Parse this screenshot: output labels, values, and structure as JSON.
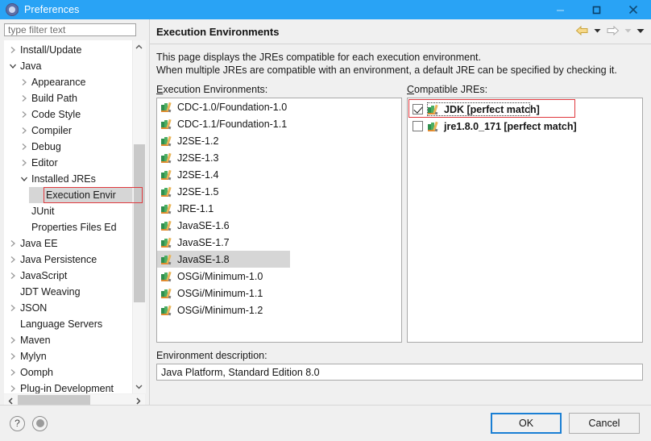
{
  "window": {
    "title": "Preferences",
    "icon": "gear-icon",
    "accent_blue": "#29a3f5",
    "controls": {
      "minimize": "minimize-icon",
      "maximize": "maximize-icon",
      "close": "close-icon"
    }
  },
  "sidebar": {
    "filter": {
      "placeholder": "type filter text",
      "value": ""
    },
    "items": [
      {
        "label": "Install/Update",
        "level": 1,
        "twisty": "collapsed"
      },
      {
        "label": "Java",
        "level": 1,
        "twisty": "expanded"
      },
      {
        "label": "Appearance",
        "level": 2,
        "twisty": "collapsed"
      },
      {
        "label": "Build Path",
        "level": 2,
        "twisty": "collapsed"
      },
      {
        "label": "Code Style",
        "level": 2,
        "twisty": "collapsed"
      },
      {
        "label": "Compiler",
        "level": 2,
        "twisty": "collapsed"
      },
      {
        "label": "Debug",
        "level": 2,
        "twisty": "collapsed"
      },
      {
        "label": "Editor",
        "level": 2,
        "twisty": "collapsed"
      },
      {
        "label": "Installed JREs",
        "level": 2,
        "twisty": "expanded"
      },
      {
        "label": "Execution Envir",
        "level": 3,
        "twisty": "none",
        "selected": true,
        "highlighted": true
      },
      {
        "label": "JUnit",
        "level": 2,
        "twisty": "none"
      },
      {
        "label": "Properties Files Ed",
        "level": 2,
        "twisty": "none"
      },
      {
        "label": "Java EE",
        "level": 1,
        "twisty": "collapsed"
      },
      {
        "label": "Java Persistence",
        "level": 1,
        "twisty": "collapsed"
      },
      {
        "label": "JavaScript",
        "level": 1,
        "twisty": "collapsed"
      },
      {
        "label": "JDT Weaving",
        "level": 1,
        "twisty": "none"
      },
      {
        "label": "JSON",
        "level": 1,
        "twisty": "collapsed"
      },
      {
        "label": "Language Servers",
        "level": 1,
        "twisty": "none"
      },
      {
        "label": "Maven",
        "level": 1,
        "twisty": "collapsed"
      },
      {
        "label": "Mylyn",
        "level": 1,
        "twisty": "collapsed"
      },
      {
        "label": "Oomph",
        "level": 1,
        "twisty": "collapsed"
      },
      {
        "label": "Plug-in Development",
        "level": 1,
        "twisty": "collapsed"
      }
    ]
  },
  "page": {
    "title": "Execution Environments",
    "intro_line1": "This page displays the JREs compatible for each execution environment.",
    "intro_line2": "When multiple JREs are compatible with an environment, a default JRE can be specified by checking it.",
    "nav": {
      "back": "back-arrow-icon",
      "back_menu": "chevron-down-icon",
      "forward": "forward-arrow-icon",
      "forward_menu": "chevron-down-icon",
      "view_menu": "chevron-down-icon"
    },
    "environments": {
      "label": "Execution Environments:",
      "label_accesskey": "E",
      "items": [
        {
          "label": "CDC-1.0/Foundation-1.0",
          "selected": false
        },
        {
          "label": "CDC-1.1/Foundation-1.1",
          "selected": false
        },
        {
          "label": "J2SE-1.2",
          "selected": false
        },
        {
          "label": "J2SE-1.3",
          "selected": false
        },
        {
          "label": "J2SE-1.4",
          "selected": false
        },
        {
          "label": "J2SE-1.5",
          "selected": false
        },
        {
          "label": "JRE-1.1",
          "selected": false
        },
        {
          "label": "JavaSE-1.6",
          "selected": false
        },
        {
          "label": "JavaSE-1.7",
          "selected": false
        },
        {
          "label": "JavaSE-1.8",
          "selected": true
        },
        {
          "label": "OSGi/Minimum-1.0",
          "selected": false
        },
        {
          "label": "OSGi/Minimum-1.1",
          "selected": false
        },
        {
          "label": "OSGi/Minimum-1.2",
          "selected": false
        }
      ]
    },
    "compatible_jres": {
      "label": "Compatible JREs:",
      "label_accesskey": "C",
      "items": [
        {
          "label": "JDK [perfect match]",
          "checked": true,
          "focused": true,
          "highlighted": true
        },
        {
          "label": "jre1.8.0_171 [perfect match]",
          "checked": false,
          "focused": false,
          "highlighted": false
        }
      ]
    },
    "description": {
      "label": "Environment description:",
      "value": "Java Platform, Standard Edition 8.0"
    }
  },
  "footer": {
    "help_icon": "help-icon",
    "secondary_icon": "apply-icon",
    "ok_label": "OK",
    "cancel_label": "Cancel",
    "focus_color": "#1a7fd4"
  },
  "annotation": {
    "color": "#e0393e"
  }
}
